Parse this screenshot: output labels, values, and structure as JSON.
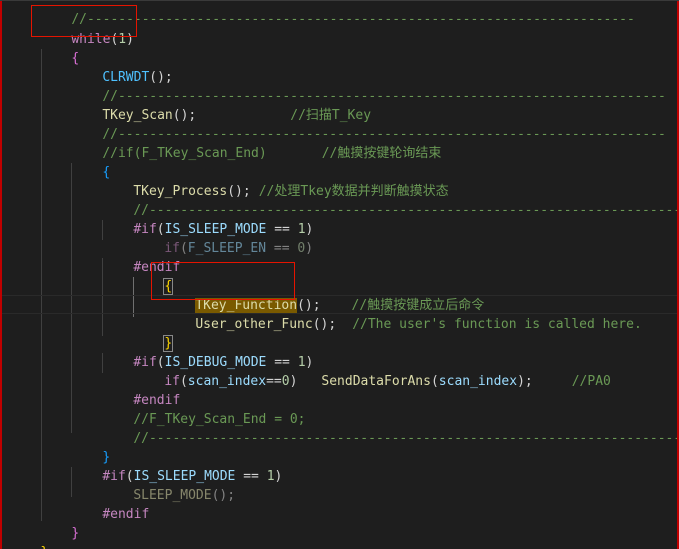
{
  "code": {
    "top_dashes": "//----------------------------------------------------------------------",
    "while_kw": "while",
    "while_open": "(",
    "while_num": "1",
    "while_close": ")",
    "brace_open_1": "{",
    "clrwdt": "CLRWDT",
    "clrwdt_tail": "();",
    "dash_line_1": "//----------------------------------------------------------------------",
    "tkey_scan": "TKey_Scan",
    "tkey_scan_tail": "();",
    "tkey_scan_comment": "//扫描T_Key",
    "dash_line_2": "//----------------------------------------------------------------------",
    "if_end_comment_a": "//if(F_TKey_Scan_End)",
    "if_end_comment_b": "//触摸按键轮询结束",
    "brace_open_2": "{",
    "tkey_process": "TKey_Process",
    "tkey_process_tail": "();",
    "tkey_process_comment": "//处理Tkey数据并判断触摸状态",
    "dash_line_3": "//----------------------------------------------------------------------",
    "pp_if_1": "#if",
    "pp_if_1_open": "(",
    "is_sleep_mode_1": "IS_SLEEP_MODE",
    "pp_if_1_eq": " == ",
    "pp_if_1_num": "1",
    "pp_if_1_close": ")",
    "if_sleep_kw": "if",
    "if_sleep_open": "(",
    "f_sleep_en": "F_SLEEP_EN",
    "if_sleep_eq": " == ",
    "if_sleep_num": "0",
    "if_sleep_close": ")",
    "pp_endif_1": "#endif",
    "brace_open_3": "{",
    "tkey_function": "TKey_Function",
    "tkey_function_tail": "();",
    "tkey_function_comment": "//触摸按键成立后命令",
    "user_other_func": "User_other_Func",
    "user_other_func_tail": "();",
    "user_other_func_comment": "//The user's function is called here.",
    "brace_close_3": "}",
    "pp_if_2": "#if",
    "pp_if_2_open": "(",
    "is_debug_mode": "IS_DEBUG_MODE",
    "pp_if_2_eq": " == ",
    "pp_if_2_num": "1",
    "pp_if_2_close": ")",
    "if_scan_kw": "if",
    "if_scan_open": "(",
    "scan_index_1": "scan_index",
    "if_scan_eq": "==",
    "if_scan_num": "0",
    "if_scan_close": ")",
    "send_data": "SendDataForAns",
    "send_open": "(",
    "scan_index_2": "scan_index",
    "send_close": ");",
    "send_comment": "//PA0",
    "pp_endif_2": "#endif",
    "scan_end_comment": "//F_TKey_Scan_End = 0;",
    "dash_line_4": "//----------------------------------------------------------------------",
    "brace_close_2": "}",
    "pp_if_3": "#if",
    "pp_if_3_open": "(",
    "is_sleep_mode_2": "IS_SLEEP_MODE",
    "pp_if_3_eq": " == ",
    "pp_if_3_num": "1",
    "pp_if_3_close": ")",
    "sleep_mode_fn": "SLEEP_MODE",
    "sleep_mode_tail": "();",
    "pp_endif_3": "#endif",
    "brace_close_1": "}",
    "brace_close_0": "}"
  },
  "colors": {
    "background": "#1e1e1e",
    "keyword": "#c586c0",
    "identifier": "#9cdcfe",
    "function": "#dcdcaa",
    "number": "#b5cea8",
    "comment": "#6a9955",
    "annotation_box": "#e51400",
    "word_highlight": "#7a5a00"
  }
}
